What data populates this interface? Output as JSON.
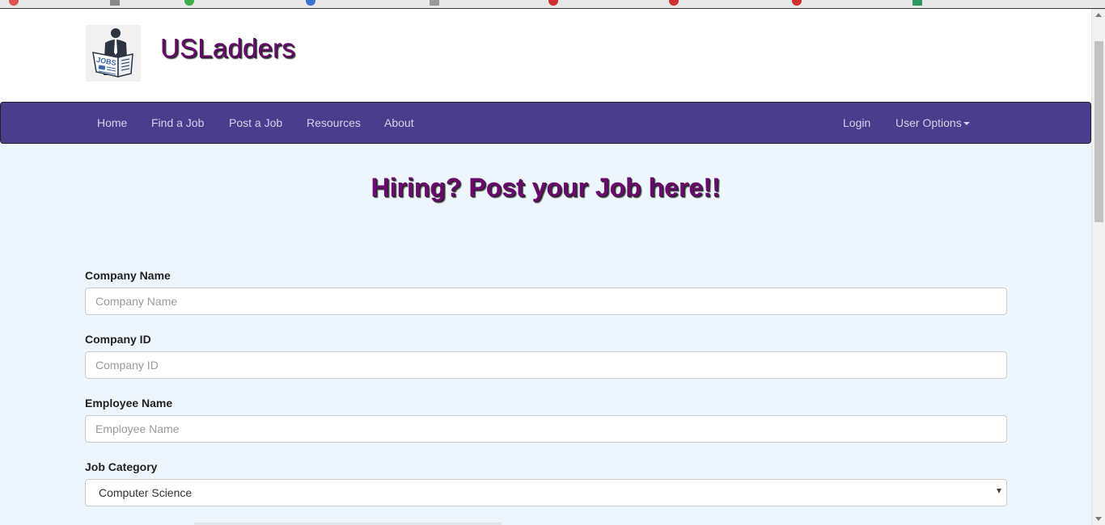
{
  "brand": {
    "name": "USLadders",
    "logo_icon": "jobs-newspaper-logo"
  },
  "nav": {
    "left_items": [
      "Home",
      "Find a Job",
      "Post a Job",
      "Resources",
      "About"
    ],
    "login": "Login",
    "user_options": "User Options"
  },
  "page": {
    "title": "Hiring? Post your Job here!!"
  },
  "form": {
    "company_name": {
      "label": "Company Name",
      "placeholder": "Company Name"
    },
    "company_id": {
      "label": "Company ID",
      "placeholder": "Company ID"
    },
    "employee_name": {
      "label": "Employee Name",
      "placeholder": "Employee Name"
    },
    "job_category": {
      "label": "Job Category",
      "value": "Computer Science"
    }
  },
  "colors": {
    "navbar": "#4b3d8e",
    "brand_text": "#6a0a6e",
    "page_background": "#eef6fd"
  }
}
